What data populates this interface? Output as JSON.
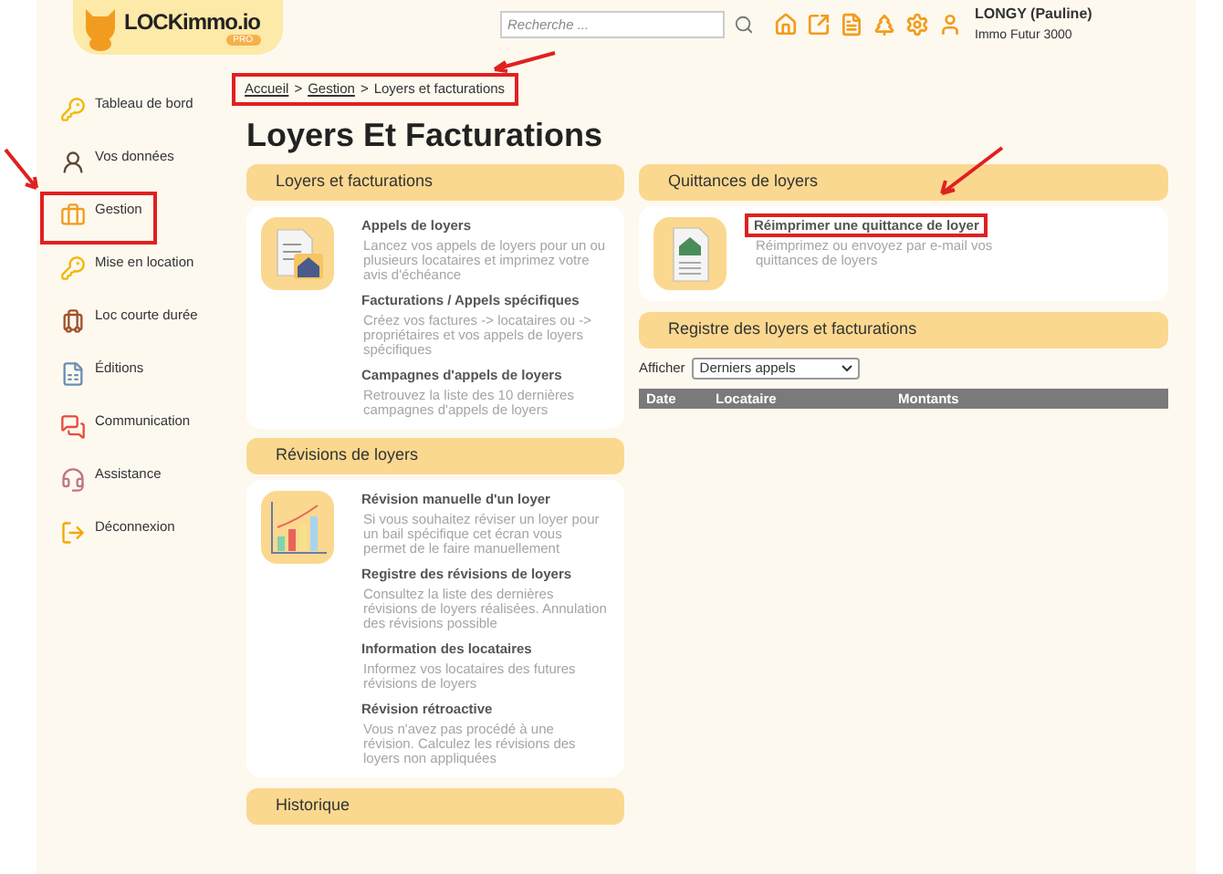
{
  "header": {
    "logo": {
      "name": "LOCKimmo.io",
      "badge": "PRO"
    },
    "search": {
      "placeholder": "Recherche ..."
    },
    "user": {
      "name": "LONGY (Pauline)",
      "company": "Immo Futur 3000"
    }
  },
  "breadcrumb": {
    "highlighted": true,
    "items": [
      {
        "label": "Accueil",
        "kind": "link"
      },
      {
        "label": ">",
        "kind": "separator"
      },
      {
        "label": "Gestion",
        "kind": "link"
      },
      {
        "label": ">",
        "kind": "separator"
      },
      {
        "label": "Loyers et facturations",
        "kind": "current"
      }
    ]
  },
  "sidebar": {
    "items": [
      {
        "label": "Tableau de bord",
        "kind": "dashboard",
        "highlighted": false
      },
      {
        "label": "Vos données",
        "kind": "profile",
        "highlighted": false
      },
      {
        "label": "Gestion",
        "kind": "management",
        "highlighted": true
      },
      {
        "label": "Mise en location",
        "kind": "rental",
        "highlighted": false
      },
      {
        "label": "Loc courte durée",
        "kind": "short",
        "highlighted": false
      },
      {
        "label": "Éditions",
        "kind": "editions",
        "highlighted": false
      },
      {
        "label": "Communication",
        "kind": "communication",
        "highlighted": false
      },
      {
        "label": "Assistance",
        "kind": "support",
        "highlighted": false
      },
      {
        "label": "Déconnexion",
        "kind": "logout",
        "highlighted": false
      }
    ]
  },
  "page_title": "Loyers Et Facturations",
  "left_sections": [
    {
      "title": "Loyers et facturations",
      "kind": "rent",
      "entries": [
        {
          "title": "Appels de loyers",
          "description": "Lancez vos appels de loyers pour un ou plusieurs locataires et imprimez votre avis d'échéance",
          "highlighted": false
        },
        {
          "title": "Facturations / Appels spécifiques",
          "description": "Créez vos factures -> locataires ou -> propriétaires et vos appels de loyers spécifiques",
          "highlighted": false
        },
        {
          "title": "Campagnes d'appels de loyers",
          "description": "Retrouvez la liste des 10 dernières campagnes d'appels de loyers",
          "highlighted": false
        }
      ]
    },
    {
      "title": "Révisions de loyers",
      "kind": "revision",
      "entries": [
        {
          "title": "Révision manuelle d'un loyer",
          "description": "Si vous souhaitez réviser un loyer pour un bail spécifique cet écran vous permet de le faire manuellement",
          "highlighted": false
        },
        {
          "title": "Registre des révisions de loyers",
          "description": "Consultez la liste des dernières révisions de loyers réalisées. Annulation des révisions possible",
          "highlighted": false
        },
        {
          "title": "Information des locataires",
          "description": "Informez vos locataires des futures révisions de loyers",
          "highlighted": false
        },
        {
          "title": "Révision rétroactive",
          "description": "Vous n'avez pas procédé à une révision. Calculez les révisions des loyers non appliquées",
          "highlighted": false
        }
      ]
    },
    {
      "title": "Historique",
      "kind": "history"
    }
  ],
  "right_sections": [
    {
      "title": "Quittances de loyers",
      "kind": "receipt",
      "entries": [
        {
          "title": "Réimprimer une quittance de loyer",
          "description": "Réimprimez ou envoyez par e-mail vos quittances de loyers",
          "highlighted": true
        }
      ]
    },
    {
      "title": "Registre des loyers et facturations",
      "kind": "register",
      "filter": {
        "label": "Afficher",
        "value": "Derniers appels"
      },
      "columns": [
        "Date",
        "Locataire",
        "Montants"
      ]
    }
  ]
}
